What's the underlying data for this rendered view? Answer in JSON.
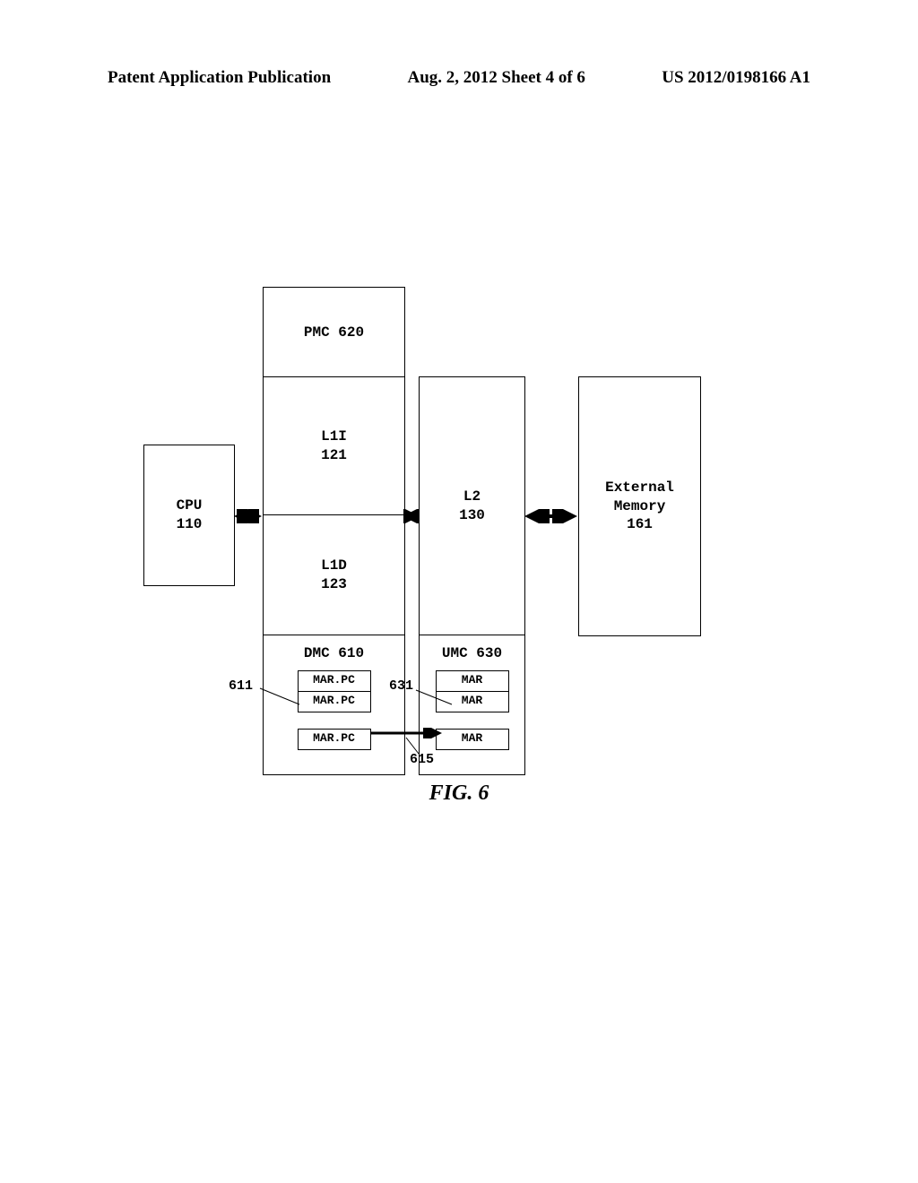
{
  "header": {
    "left": "Patent Application Publication",
    "center": "Aug. 2, 2012  Sheet 4 of 6",
    "right": "US 2012/0198166 A1"
  },
  "cpu": {
    "name": "CPU",
    "num": "110"
  },
  "pmc": {
    "label": "PMC 620"
  },
  "l1i": {
    "name": "L1I",
    "num": "121"
  },
  "l1d": {
    "name": "L1D",
    "num": "123"
  },
  "l2": {
    "name": "L2",
    "num": "130"
  },
  "ext": {
    "name": "External",
    "name2": "Memory",
    "num": "161"
  },
  "dmc": {
    "label": "DMC 610",
    "regs": [
      "MAR.PC",
      "MAR.PC",
      "MAR.PC"
    ]
  },
  "umc": {
    "label": "UMC 630",
    "regs": [
      "MAR",
      "MAR",
      "MAR"
    ]
  },
  "refs": {
    "r611": "611",
    "r631": "631",
    "r615": "615"
  },
  "figure": "FIG. 6"
}
